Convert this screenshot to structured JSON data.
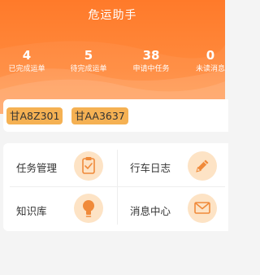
{
  "header": {
    "title": "危运助手"
  },
  "stats": [
    {
      "value": "4",
      "label": "已完成运单"
    },
    {
      "value": "5",
      "label": "待完成运单"
    },
    {
      "value": "38",
      "label": "申请中任务"
    },
    {
      "value": "0",
      "label": "未读消息"
    }
  ],
  "plates": [
    "甘A8Z301",
    "甘AA3637"
  ],
  "menu": [
    {
      "label": "任务管理",
      "icon": "clipboard-check-icon"
    },
    {
      "label": "行车日志",
      "icon": "pencil-icon"
    },
    {
      "label": "知识库",
      "icon": "lightbulb-icon"
    },
    {
      "label": "消息中心",
      "icon": "envelope-icon"
    }
  ],
  "colors": {
    "header": "#ff7a2a",
    "plate": "#f5b153",
    "icon_bg": "#fde3c5",
    "icon_fg": "#f08a3a"
  }
}
